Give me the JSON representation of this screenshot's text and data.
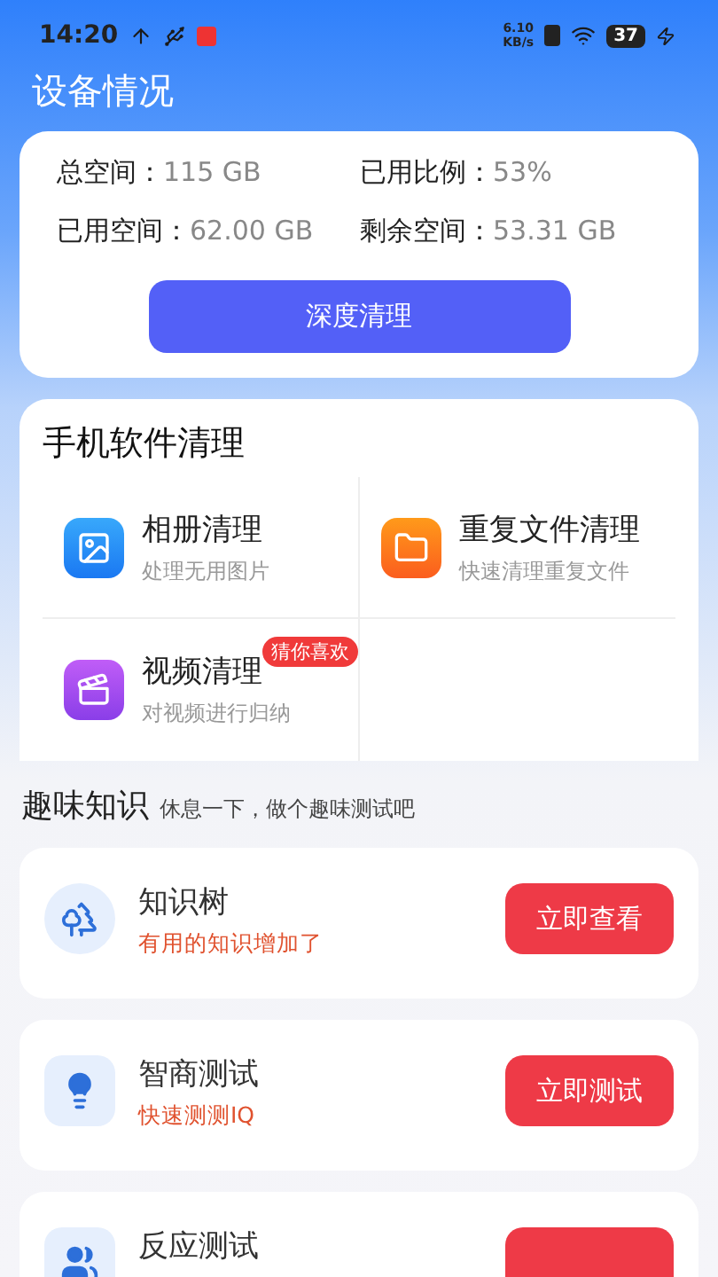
{
  "status_bar": {
    "time": "14:20",
    "speed_value": "6.10",
    "speed_unit": "KB/s",
    "battery": "37"
  },
  "title": "设备情况",
  "storage": {
    "stats": [
      {
        "label": "总空间：",
        "value": "115 GB"
      },
      {
        "label": "已用比例：",
        "value": "53%"
      },
      {
        "label": "已用空间：",
        "value": "62.00 GB"
      },
      {
        "label": "剩余空间：",
        "value": "53.31 GB"
      }
    ],
    "button": "深度清理"
  },
  "cleanup": {
    "title": "手机软件清理",
    "items": [
      {
        "kind": "gallery",
        "title": "相册清理",
        "subtitle": "处理无用图片"
      },
      {
        "kind": "folder",
        "title": "重复文件清理",
        "subtitle": "快速清理重复文件"
      },
      {
        "kind": "video",
        "title": "视频清理",
        "subtitle": "对视频进行归纳",
        "badge": "猜你喜欢"
      }
    ]
  },
  "fun": {
    "title": "趣味知识",
    "subtitle": "休息一下，做个趣味测试吧",
    "items": [
      {
        "kind": "tree",
        "title": "知识树",
        "subtitle": "有用的知识增加了",
        "button": "立即查看"
      },
      {
        "kind": "bulb",
        "title": "智商测试",
        "subtitle": "快速测测IQ",
        "button": "立即测试"
      },
      {
        "kind": "people",
        "title": "反应测试"
      }
    ]
  }
}
